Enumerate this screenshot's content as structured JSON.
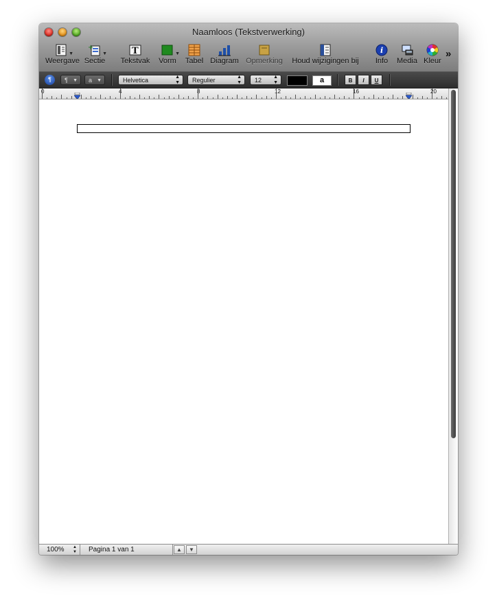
{
  "window": {
    "title": "Naamloos (Tekstverwerking)"
  },
  "toolbar": {
    "weergave": "Weergave",
    "sectie": "Sectie",
    "tekstvak": "Tekstvak",
    "vorm": "Vorm",
    "tabel": "Tabel",
    "diagram": "Diagram",
    "opmerking": "Opmerking",
    "houd": "Houd wijzigingen bij",
    "info": "Info",
    "media": "Media",
    "kleur": "Kleur",
    "more": "»"
  },
  "format": {
    "paragraph_style": "¶",
    "char_style": "a",
    "font": "Helvetica",
    "typeface": "Regulier",
    "size": "12",
    "highlight_letter": "a",
    "bold": "B",
    "italic": "I",
    "underline": "U"
  },
  "ruler": {
    "labels": [
      "0",
      "4",
      "8",
      "12",
      "16",
      "20"
    ]
  },
  "status": {
    "zoom": "100%",
    "page": "Pagina 1 van 1"
  },
  "colors": {
    "accent": "#1e4fa8",
    "titlebar": "#9d9d9d",
    "formatbar": "#333333"
  }
}
